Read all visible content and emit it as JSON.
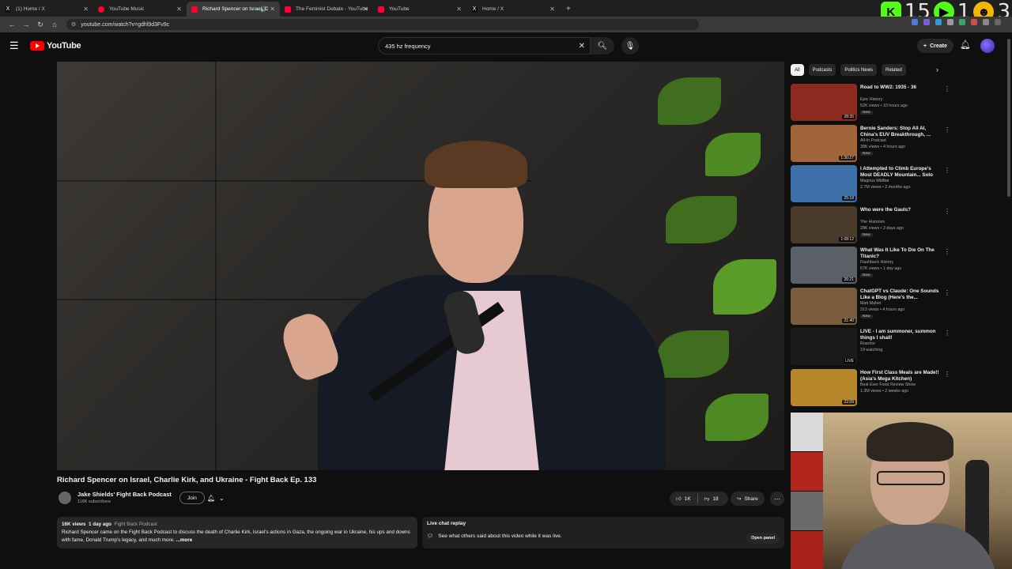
{
  "browser": {
    "tabs": [
      {
        "label": "(1) Home / X",
        "favicon_color": "#111111",
        "favicon_glyph": "X",
        "active": false
      },
      {
        "label": "YouTube Music",
        "favicon_color": "#ff0033",
        "favicon_glyph": "",
        "active": false
      },
      {
        "label": "Richard Spencer on Israel, C",
        "favicon_color": "#ff0033",
        "favicon_glyph": "",
        "active": true
      },
      {
        "label": "The Feminist Debate - YouTube",
        "favicon_color": "#ff0033",
        "favicon_glyph": "",
        "active": false
      },
      {
        "label": "YouTube",
        "favicon_color": "#ff0033",
        "favicon_glyph": "",
        "active": false
      },
      {
        "label": "Home / X",
        "favicon_color": "#111111",
        "favicon_glyph": "X",
        "active": false
      }
    ],
    "url": "youtube.com/watch?v=gdhl9d3Fv9c"
  },
  "overlay": {
    "count_a": "15",
    "count_b": "1",
    "count_c": "3"
  },
  "header": {
    "logo_text": "YouTube",
    "search_value": "435 hz frequency",
    "create_label": "Create"
  },
  "video": {
    "title": "Richard Spencer on Israel, Charlie Kirk, and Ukraine - Fight Back Ep. 133",
    "channel_name": "Jake Shields' Fight Back Podcast",
    "subscribers": "116K subscribers",
    "join_label": "Join",
    "likes": "1K",
    "dislikes": "18",
    "share_label": "Share",
    "description": {
      "views": "16K views",
      "age": "1 day ago",
      "tag": "Fight Back Podcast",
      "text": "Richard Spencer came on the Fight Back Podcast to discuss the death of Charlie Kirk, Israel's actions in Gaza, the ongoing war in Ukraine, his ups and downs with fame, Donald Trump's legacy, and much more.",
      "more_label": "...more"
    },
    "live_chat": {
      "title": "Live chat replay",
      "text": "See what others said about this video while it was live.",
      "button": "Open panel"
    }
  },
  "sidebar": {
    "chips": [
      "All",
      "Podcasts",
      "Politics News",
      "Related"
    ],
    "recommendations": [
      {
        "title": "Road to WW2: 1935 - 36",
        "channel": "Epic History",
        "views": "52K views • 10 hours ago",
        "badge": "New",
        "duration": "28:35",
        "color": "#8b2a1f"
      },
      {
        "title": "Bernie Sanders: Stop All AI, China's EUV Breakthrough, ...",
        "channel": "All-In Podcast",
        "views": "38K views • 4 hours ago",
        "badge": "New",
        "duration": "1:30:27",
        "color": "#a0663a"
      },
      {
        "title": "I Attempted to Climb Europe's Most DEADLY Mountain... Solo",
        "channel": "Magnus Midtbø",
        "views": "2.7M views • 2 months ago",
        "badge": "",
        "duration": "25:18",
        "color": "#3d6fa8"
      },
      {
        "title": "Who were the Gauls?",
        "channel": "The Histories",
        "views": "28K views • 2 days ago",
        "badge": "New",
        "duration": "1:08:12",
        "color": "#4a3a2c"
      },
      {
        "title": "What Was It Like To Die On The Titanic?",
        "channel": "Flashback History",
        "views": "67K views • 1 day ago",
        "badge": "New",
        "duration": "26:21",
        "color": "#5b5f66"
      },
      {
        "title": "ChatGPT vs Claude: One Sounds Like a Blog (Here's the...",
        "channel": "Matt Maher",
        "views": "313 views • 4 hours ago",
        "badge": "New",
        "duration": "21:40",
        "color": "#7a5c3c"
      },
      {
        "title": "LIVE - I am summoner, summon things I shall!",
        "channel": "Roarrior",
        "views": "19 watching",
        "badge": "",
        "duration": "LIVE",
        "color": "#1a1a1a"
      },
      {
        "title": "How First Class Meals are Made!! (Asia's Mega Kitchen)",
        "channel": "Best Ever Food Review Show",
        "views": "1.3M views • 2 weeks ago",
        "badge": "",
        "duration": "22:09",
        "color": "#b8862a"
      }
    ]
  }
}
